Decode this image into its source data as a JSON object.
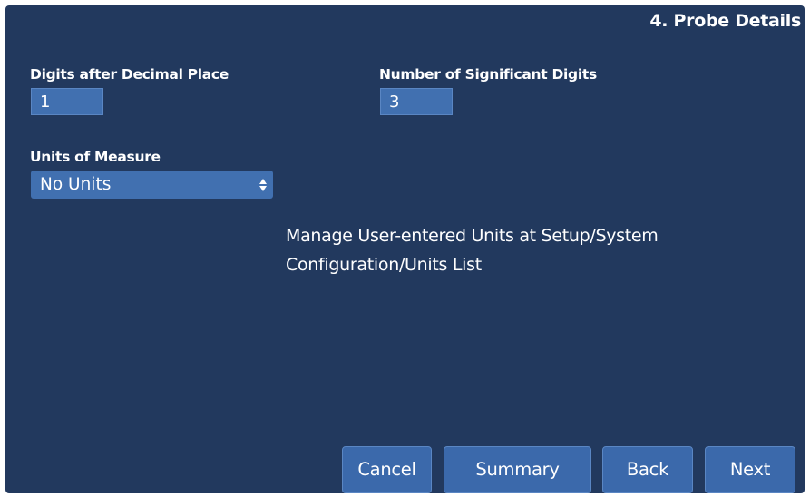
{
  "header": {
    "step_title": "4. Probe Details"
  },
  "fields": {
    "digits_after_decimal": {
      "label": "Digits after Decimal Place",
      "value": "1"
    },
    "significant_digits": {
      "label": "Number of Significant Digits",
      "value": "3"
    },
    "units_of_measure": {
      "label": "Units of Measure",
      "selected": "No Units"
    }
  },
  "info": {
    "line1": "Manage User-entered Units at Setup/System",
    "line2": "Configuration/Units List"
  },
  "buttons": {
    "cancel": "Cancel",
    "summary": "Summary",
    "back": "Back",
    "next": "Next"
  },
  "colors": {
    "panel_background": "#22395e",
    "input_background": "#4170b0",
    "button_background": "#3b69ab",
    "text": "#ffffff"
  }
}
